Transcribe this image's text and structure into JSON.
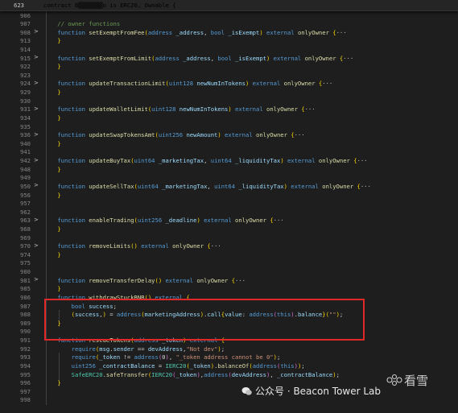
{
  "sticky": {
    "line": "623",
    "code": "contract B▒▒▒▒▒▒▒o is ERC20, Ownable {"
  },
  "lines": [
    {
      "n": "906",
      "fold": "",
      "code": ""
    },
    {
      "n": "907",
      "fold": "",
      "code": "    // owner functions"
    },
    {
      "n": "908",
      "fold": ">",
      "code": "    function setExemptFromFee(address _address, bool _isExempt) external onlyOwner {···"
    },
    {
      "n": "913",
      "fold": "",
      "code": "    }"
    },
    {
      "n": "914",
      "fold": "",
      "code": ""
    },
    {
      "n": "915",
      "fold": ">",
      "code": "    function setExemptFromLimit(address _address, bool _isExempt) external onlyOwner {···"
    },
    {
      "n": "922",
      "fold": "",
      "code": "    }"
    },
    {
      "n": "923",
      "fold": "",
      "code": ""
    },
    {
      "n": "924",
      "fold": ">",
      "code": "    function updateTransactionLimit(uint128 newNumInTokens) external onlyOwner {···"
    },
    {
      "n": "929",
      "fold": "",
      "code": "    }"
    },
    {
      "n": "930",
      "fold": "",
      "code": ""
    },
    {
      "n": "931",
      "fold": ">",
      "code": "    function updateWalletLimit(uint128 newNumInTokens) external onlyOwner {···"
    },
    {
      "n": "934",
      "fold": "",
      "code": "    }"
    },
    {
      "n": "935",
      "fold": "",
      "code": ""
    },
    {
      "n": "936",
      "fold": ">",
      "code": "    function updateSwapTokensAmt(uint256 newAmount) external onlyOwner {···"
    },
    {
      "n": "940",
      "fold": "",
      "code": "    }"
    },
    {
      "n": "941",
      "fold": "",
      "code": ""
    },
    {
      "n": "942",
      "fold": ">",
      "code": "    function updateBuyTax(uint64 _marketingTax, uint64 _liquidityTax) external onlyOwner {···"
    },
    {
      "n": "948",
      "fold": "",
      "code": "    }"
    },
    {
      "n": "949",
      "fold": "",
      "code": ""
    },
    {
      "n": "950",
      "fold": ">",
      "code": "    function updateSellTax(uint64 _marketingTax, uint64 _liquidityTax) external onlyOwner {···"
    },
    {
      "n": "956",
      "fold": "",
      "code": "    }"
    },
    {
      "n": "957",
      "fold": "",
      "code": ""
    },
    {
      "n": "962",
      "fold": "",
      "code": ""
    },
    {
      "n": "963",
      "fold": ">",
      "code": "    function enableTrading(uint256 _deadline) external onlyOwner {···"
    },
    {
      "n": "968",
      "fold": "",
      "code": "    }"
    },
    {
      "n": "969",
      "fold": "",
      "code": ""
    },
    {
      "n": "970",
      "fold": ">",
      "code": "    function removeLimits() external onlyOwner {···"
    },
    {
      "n": "974",
      "fold": "",
      "code": "    }"
    },
    {
      "n": "975",
      "fold": "",
      "code": ""
    },
    {
      "n": "980",
      "fold": "",
      "code": ""
    },
    {
      "n": "981",
      "fold": ">",
      "code": "    function removeTransferDelay() external onlyOwner {···"
    },
    {
      "n": "985",
      "fold": "",
      "code": "    }"
    },
    {
      "n": "986",
      "fold": "",
      "code": "    function withdrawStuckBNB() external {"
    },
    {
      "n": "987",
      "fold": "",
      "code": "        bool success;"
    },
    {
      "n": "988",
      "fold": "",
      "code": "        (success,) = address(marketingAddress).call{value: address(this).balance}(\"\");"
    },
    {
      "n": "989",
      "fold": "",
      "code": "    }"
    },
    {
      "n": "990",
      "fold": "",
      "code": ""
    },
    {
      "n": "991",
      "fold": "",
      "code": "    function rescueTokens(address _token) external {"
    },
    {
      "n": "992",
      "fold": "",
      "code": "        require(msg.sender == devAddress,\"Not dev\");"
    },
    {
      "n": "993",
      "fold": "",
      "code": "        require(_token != address(0), \"_token address cannot be 0\");"
    },
    {
      "n": "994",
      "fold": "",
      "code": "        uint256 _contractBalance = IERC20(_token).balanceOf(address(this));"
    },
    {
      "n": "995",
      "fold": "",
      "code": "        SafeERC20.safeTransfer(IERC20(_token),address(devAddress), _contractBalance);"
    },
    {
      "n": "996",
      "fold": "",
      "code": "    }"
    },
    {
      "n": "997",
      "fold": "",
      "code": ""
    },
    {
      "n": "998",
      "fold": "",
      "code": ""
    }
  ],
  "watermark": {
    "text": "公众号 · Beacon Tower Lab",
    "logo_text": "看雪"
  },
  "colors": {
    "keyword": "#569cd6",
    "function": "#dcdcaa",
    "type": "#4ec9b0",
    "variable": "#9cdcfe",
    "string": "#ce9178",
    "comment": "#6a9955",
    "highlight_box": "#e02828",
    "background": "#1e1e1e"
  }
}
